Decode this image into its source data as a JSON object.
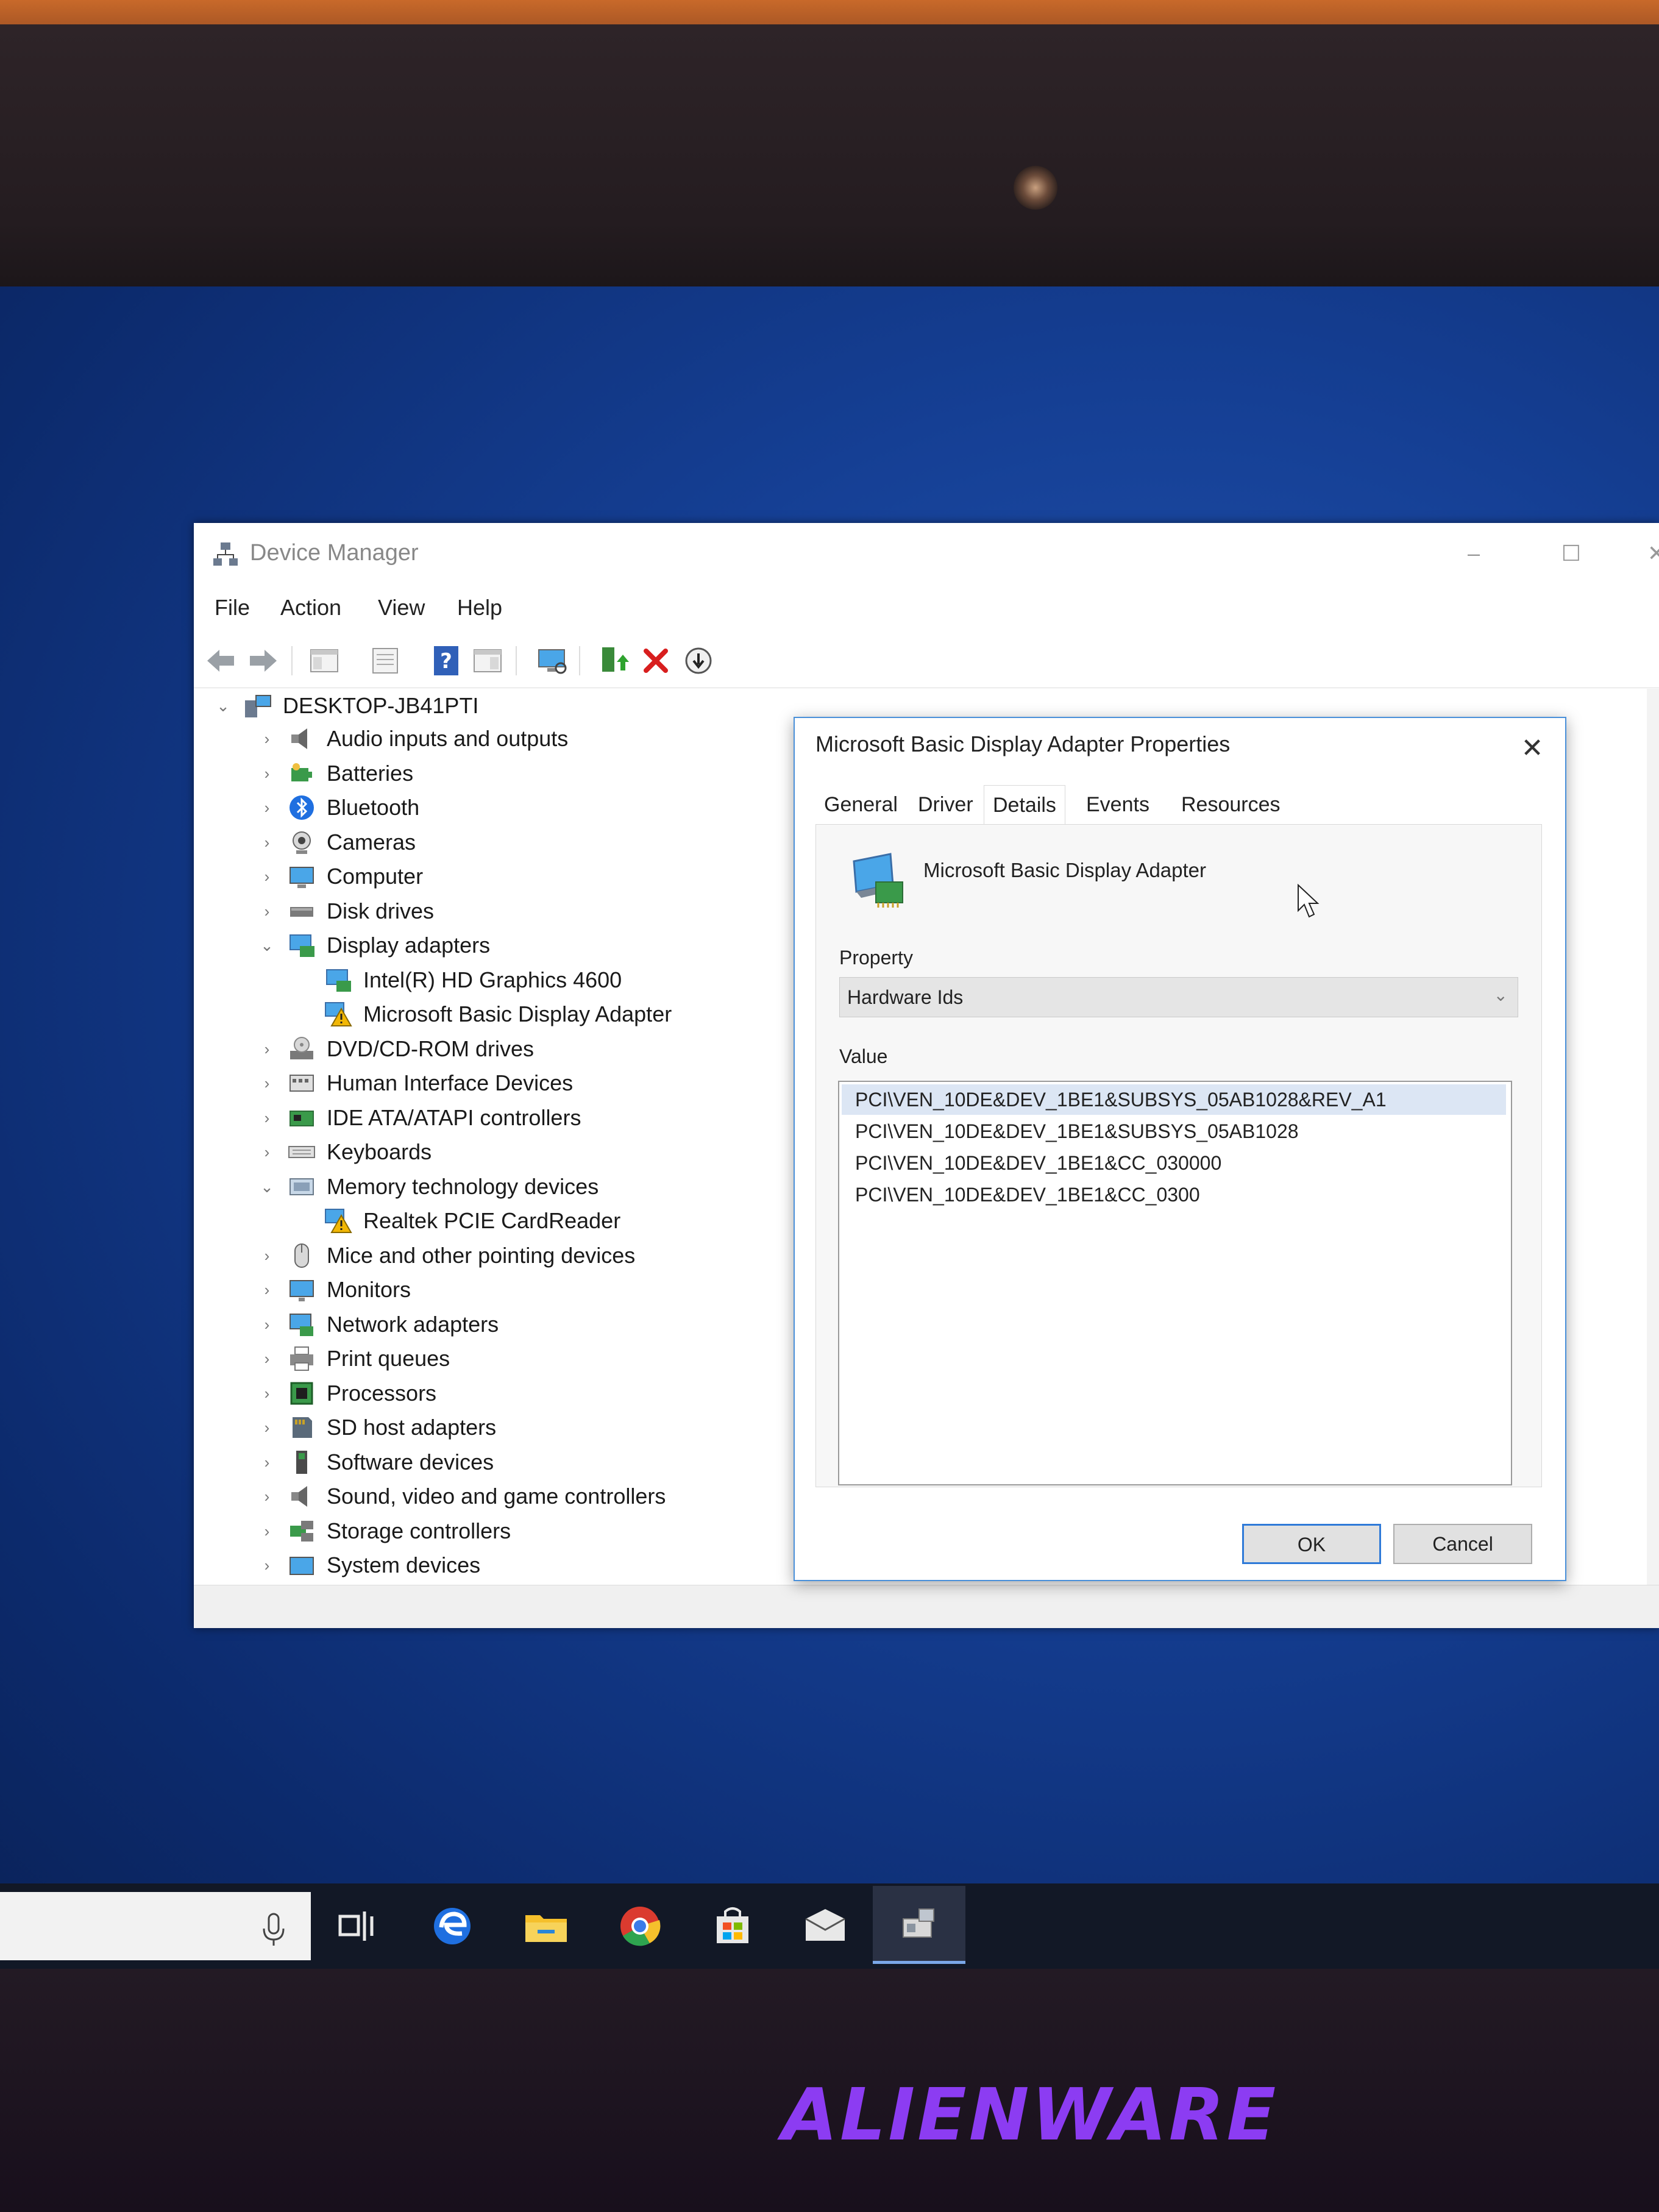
{
  "window": {
    "title": "Device Manager",
    "menu": [
      "File",
      "Action",
      "View",
      "Help"
    ]
  },
  "tree": {
    "root": "DESKTOP-JB41PTI",
    "items": [
      {
        "label": "Audio inputs and outputs",
        "expanded": false,
        "icon": "speaker-icon"
      },
      {
        "label": "Batteries",
        "expanded": false,
        "icon": "battery-icon"
      },
      {
        "label": "Bluetooth",
        "expanded": false,
        "icon": "bluetooth-icon"
      },
      {
        "label": "Cameras",
        "expanded": false,
        "icon": "camera-icon"
      },
      {
        "label": "Computer",
        "expanded": false,
        "icon": "computer-icon"
      },
      {
        "label": "Disk drives",
        "expanded": false,
        "icon": "disk-drive-icon"
      },
      {
        "label": "Display adapters",
        "expanded": true,
        "icon": "display-adapter-icon"
      },
      {
        "label": "Intel(R) HD Graphics 4600",
        "child": true,
        "icon": "display-adapter-icon"
      },
      {
        "label": "Microsoft Basic Display Adapter",
        "child": true,
        "icon": "warning-icon"
      },
      {
        "label": "DVD/CD-ROM drives",
        "expanded": false,
        "icon": "dvd-icon"
      },
      {
        "label": "Human Interface Devices",
        "expanded": false,
        "icon": "hid-icon"
      },
      {
        "label": "IDE ATA/ATAPI controllers",
        "expanded": false,
        "icon": "ide-controller-icon"
      },
      {
        "label": "Keyboards",
        "expanded": false,
        "icon": "keyboard-icon"
      },
      {
        "label": "Memory technology devices",
        "expanded": true,
        "icon": "memory-icon"
      },
      {
        "label": "Realtek PCIE CardReader",
        "child": true,
        "icon": "warning-icon"
      },
      {
        "label": "Mice and other pointing devices",
        "expanded": false,
        "icon": "mouse-icon"
      },
      {
        "label": "Monitors",
        "expanded": false,
        "icon": "monitor-icon"
      },
      {
        "label": "Network adapters",
        "expanded": false,
        "icon": "network-adapter-icon"
      },
      {
        "label": "Print queues",
        "expanded": false,
        "icon": "printer-icon"
      },
      {
        "label": "Processors",
        "expanded": false,
        "icon": "processor-icon"
      },
      {
        "label": "SD host adapters",
        "expanded": false,
        "icon": "sd-card-icon"
      },
      {
        "label": "Software devices",
        "expanded": false,
        "icon": "software-device-icon"
      },
      {
        "label": "Sound, video and game controllers",
        "expanded": false,
        "icon": "speaker-icon"
      },
      {
        "label": "Storage controllers",
        "expanded": false,
        "icon": "storage-controller-icon"
      },
      {
        "label": "System devices",
        "expanded": false,
        "icon": "system-device-icon"
      }
    ]
  },
  "dialog": {
    "title": "Microsoft Basic Display Adapter Properties",
    "tabs": [
      "General",
      "Driver",
      "Details",
      "Events",
      "Resources"
    ],
    "active_tab": "Details",
    "device_name": "Microsoft Basic Display Adapter",
    "property_label": "Property",
    "property_value": "Hardware Ids",
    "value_label": "Value",
    "values": [
      "PCI\\VEN_10DE&DEV_1BE1&SUBSYS_05AB1028&REV_A1",
      "PCI\\VEN_10DE&DEV_1BE1&SUBSYS_05AB1028",
      "PCI\\VEN_10DE&DEV_1BE1&CC_030000",
      "PCI\\VEN_10DE&DEV_1BE1&CC_0300"
    ],
    "ok_label": "OK",
    "cancel_label": "Cancel"
  },
  "brand": "ALIENWARE",
  "colors": {
    "desktop": "#153f94",
    "selection": "#dce6f4",
    "dialog_border": "#4a90d9",
    "brand": "#8c3cf2",
    "warning": "#f2b705",
    "delete": "#d81e1e"
  }
}
